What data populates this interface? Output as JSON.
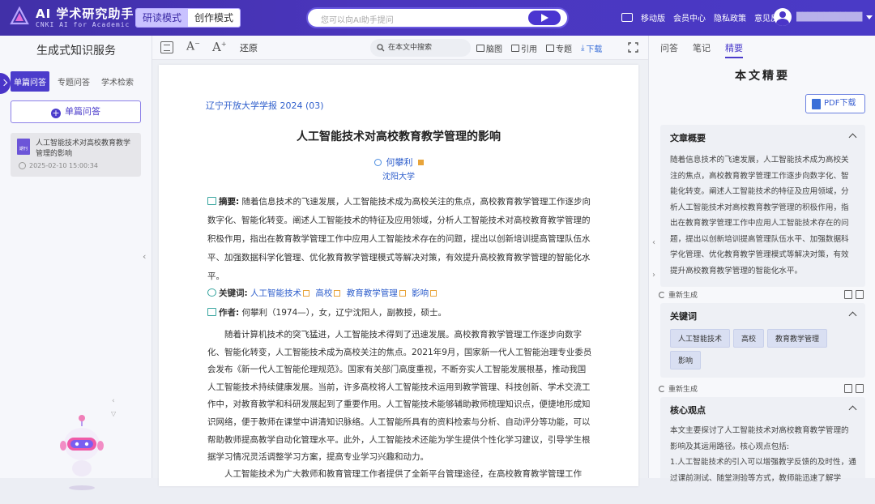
{
  "header": {
    "brand_title": "AI 学术研究助手",
    "brand_subtitle": "CNKI AI for Academic",
    "modes": [
      {
        "label": "研读模式",
        "active": true
      },
      {
        "label": "创作模式",
        "active": false
      }
    ],
    "search_placeholder": "您可以向AI助手提问",
    "actions": [
      "移动版",
      "会员中心",
      "隐私政策",
      "意见反馈"
    ],
    "user_name": "████████████",
    "accent_color": "#4a35c8"
  },
  "left_panel": {
    "title": "生成式知识服务",
    "tabs": [
      {
        "label": "单篇问答",
        "active": true
      },
      {
        "label": "专题问答",
        "active": false
      },
      {
        "label": "学术检索",
        "active": false
      }
    ],
    "new_button": "单篇问答",
    "history": [
      {
        "badge": "期刊",
        "title": "人工智能技术对高校教育教学管理的影响",
        "time": "2025-02-10 15:00:34"
      }
    ]
  },
  "toolbar": {
    "decrease_font": "A",
    "increase_font": "A",
    "restore": "还原",
    "search_label": "在本文中搜索",
    "items": [
      "脑图",
      "引用",
      "专题",
      "下载"
    ]
  },
  "document": {
    "journal": "辽宁开放大学学报 2024 (03)",
    "title": "人工智能技术对高校教育教学管理的影响",
    "author": "何攀利",
    "affiliation": "沈阳大学",
    "abstract_label": "摘要:",
    "abstract": "随着信息技术的飞速发展，人工智能技术成为高校关注的焦点，高校教育教学管理工作逐步向数字化、智能化转变。阐述人工智能技术的特征及应用领域，分析人工智能技术对高校教育教学管理的积极作用，指出在教育教学管理工作中应用人工智能技术存在的问题，提出以创新培训提高管理队伍水平、加强数据科学化管理、优化教育教学管理模式等解决对策，有效提升高校教育教学管理的智能化水平。",
    "keywords_label": "关键词:",
    "keywords": [
      "人工智能技术",
      "高校",
      "教育教学管理",
      "影响"
    ],
    "author_label": "作者:",
    "author_info": "何攀利（1974—），女，辽宁沈阳人，副教授，硕士。",
    "paragraph1": "随着计算机技术的突飞猛进，人工智能技术得到了迅速发展。高校教育教学管理工作逐步向数字化、智能化转变，人工智能技术成为高校关注的焦点。2021年9月，国家新一代人工智能治理专业委员会发布《新一代人工智能伦理规范》。国家有关部门高度重视，不断夯实人工智能发展根基，推动我国人工智能技术持续健康发展。当前，许多高校将人工智能技术运用到教学管理、科技创新、学术交流工作中，对教育教学和科研发展起到了重要作用。人工智能技术能够辅助教师梳理知识点，便捷地形成知识网络，便于教师在课堂中讲清知识脉络。人工智能所具有的资料检索与分析、自动评分等功能，可以帮助教师提高教学自动化管理水平。此外，人工智能技术还能为学生提供个性化学习建议，引导学生根据学习情况灵活调整学习方案，提高专业学习兴趣和动力。",
    "paragraph2": "人工智能技术为广大教师和教育管理工作者提供了全新平台管理途径，在高校教育教学管理工作"
  },
  "right_panel": {
    "tabs": [
      {
        "label": "问答",
        "active": false
      },
      {
        "label": "笔记",
        "active": false
      },
      {
        "label": "精要",
        "active": true
      }
    ],
    "heading": "本文精要",
    "pdf_button": "PDF下载",
    "summary_title": "文章概要",
    "summary_text": "随着信息技术的飞速发展，人工智能技术成为高校关注的焦点，高校教育教学管理工作逐步向数字化、智能化转变。阐述人工智能技术的特征及应用领域，分析人工智能技术对高校教育教学管理的积极作用，指出在教育教学管理工作中应用人工智能技术存在的问题，提出以创新培训提高管理队伍水平、加强数据科学化管理、优化教育教学管理模式等解决对策，有效提升高校教育教学管理的智能化水平。",
    "regenerate": "重新生成",
    "keywords_title": "关键词",
    "keywords": [
      "人工智能技术",
      "高校",
      "教育教学管理",
      "影响"
    ],
    "viewpoint_title": "核心观点",
    "viewpoint_text": "本文主要探讨了人工智能技术对高校教育教学管理的影响及其运用路径。核心观点包括:",
    "viewpoint_point1": "1.人工智能技术的引入可以增强教学反馈的及时性，通过课前测试、随堂测验等方式，教师能迅速了解学"
  }
}
